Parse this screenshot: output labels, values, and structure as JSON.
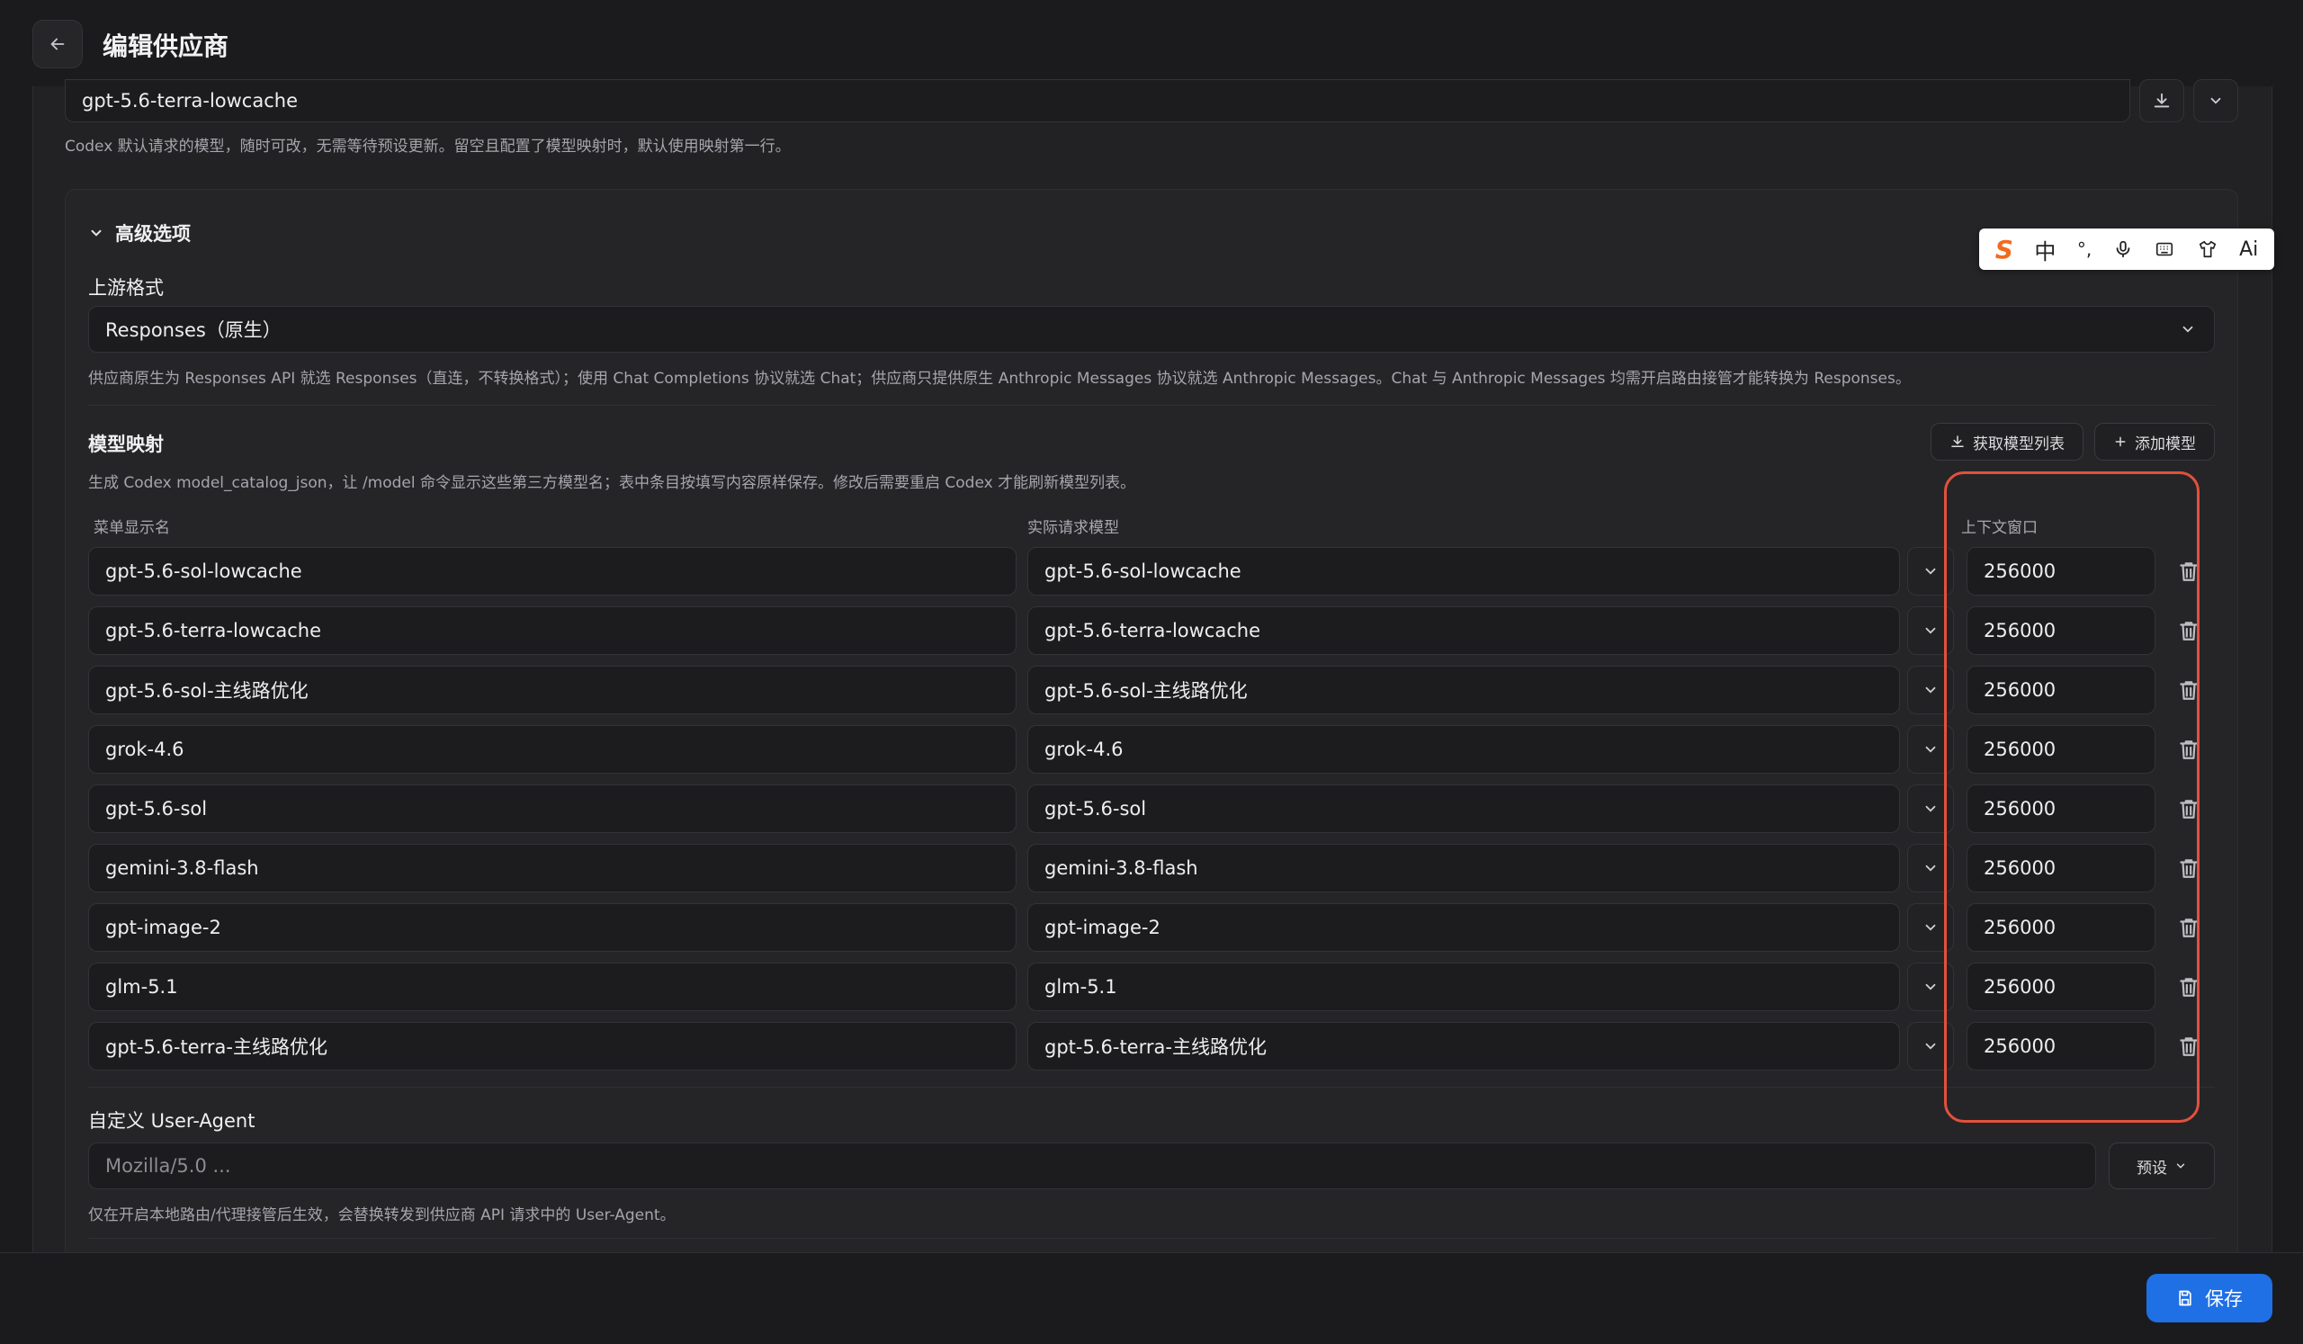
{
  "header": {
    "title": "编辑供应商"
  },
  "default_model": {
    "value": "gpt-5.6-terra-lowcache",
    "hint": "Codex 默认请求的模型，随时可改，无需等待预设更新。留空且配置了模型映射时，默认使用映射第一行。"
  },
  "advanced": {
    "title": "高级选项",
    "upstream": {
      "label": "上游格式",
      "value": "Responses（原生）",
      "hint": "供应商原生为 Responses API 就选 Responses（直连，不转换格式）；使用 Chat Completions 协议就选 Chat；供应商只提供原生 Anthropic Messages 协议就选 Anthropic Messages。Chat 与 Anthropic Messages 均需开启路由接管才能转换为 Responses。"
    },
    "mapping": {
      "label": "模型映射",
      "fetch_label": "获取模型列表",
      "add_label": "添加模型",
      "hint": "生成 Codex model_catalog_json，让 /model 命令显示这些第三方模型名；表中条目按填写内容原样保存。修改后需要重启 Codex 才能刷新模型列表。",
      "col_name": "菜单显示名",
      "col_model": "实际请求模型",
      "col_ctx": "上下文窗口",
      "rows": [
        {
          "name": "gpt-5.6-sol-lowcache",
          "model": "gpt-5.6-sol-lowcache",
          "ctx": "256000"
        },
        {
          "name": "gpt-5.6-terra-lowcache",
          "model": "gpt-5.6-terra-lowcache",
          "ctx": "256000"
        },
        {
          "name": "gpt-5.6-sol-主线路优化",
          "model": "gpt-5.6-sol-主线路优化",
          "ctx": "256000"
        },
        {
          "name": "grok-4.6",
          "model": "grok-4.6",
          "ctx": "256000"
        },
        {
          "name": "gpt-5.6-sol",
          "model": "gpt-5.6-sol",
          "ctx": "256000"
        },
        {
          "name": "gemini-3.8-flash",
          "model": "gemini-3.8-flash",
          "ctx": "256000"
        },
        {
          "name": "gpt-image-2",
          "model": "gpt-image-2",
          "ctx": "256000"
        },
        {
          "name": "glm-5.1",
          "model": "glm-5.1",
          "ctx": "256000"
        },
        {
          "name": "gpt-5.6-terra-主线路优化",
          "model": "gpt-5.6-terra-主线路优化",
          "ctx": "256000"
        }
      ]
    },
    "user_agent": {
      "label": "自定义 User-Agent",
      "placeholder": "Mozilla/5.0 ...",
      "preset_label": "预设",
      "hint": "仅在开启本地路由/代理接管后生效，会替换转发到供应商 API 请求中的 User-Agent。"
    }
  },
  "ime_toolbar": {
    "items": [
      "sogou-logo",
      "中",
      "°,",
      "mic-icon",
      "keyboard-icon",
      "shirt-icon",
      "Ai"
    ]
  },
  "footer": {
    "save_label": "保存"
  },
  "colors": {
    "accent": "#1f6fe5",
    "highlight": "#e2513c",
    "background": "#1b1b1d"
  }
}
